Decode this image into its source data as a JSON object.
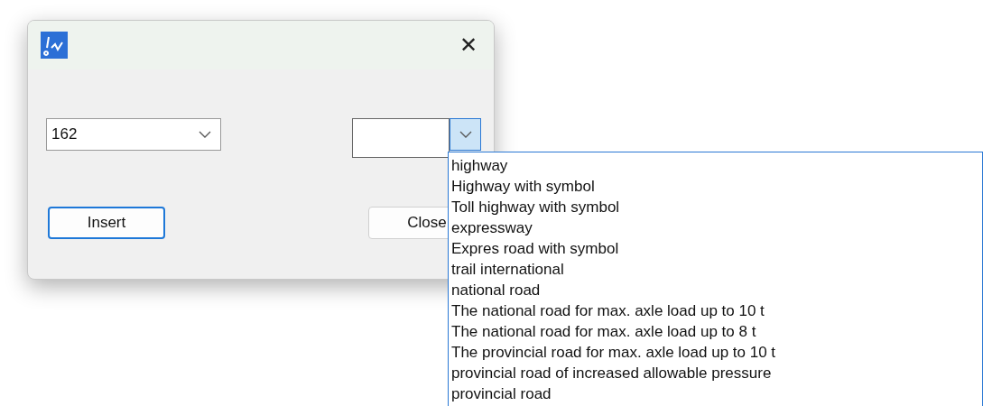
{
  "window": {
    "close": "✕"
  },
  "number_combo": {
    "value": "162"
  },
  "type_combo": {
    "expanded": true,
    "options": [
      {
        "label": "highway"
      },
      {
        "label": "Highway with symbol"
      },
      {
        "label": "Toll highway with symbol"
      },
      {
        "label": "expressway"
      },
      {
        "label": "Expres road with symbol"
      },
      {
        "label": "trail international"
      },
      {
        "label": "national road"
      },
      {
        "label": "The national road for max. axle load up to 10 t"
      },
      {
        "label": "The national road for max. axle load up to 8 t"
      },
      {
        "label": "The provincial road for max. axle load up to 10 t"
      },
      {
        "label": "provincial road of increased allowable pressure"
      },
      {
        "label": "provincial road"
      }
    ]
  },
  "buttons": [
    {
      "label": "Insert",
      "kind": "default"
    },
    {
      "label": "Close",
      "kind": "normal"
    }
  ]
}
